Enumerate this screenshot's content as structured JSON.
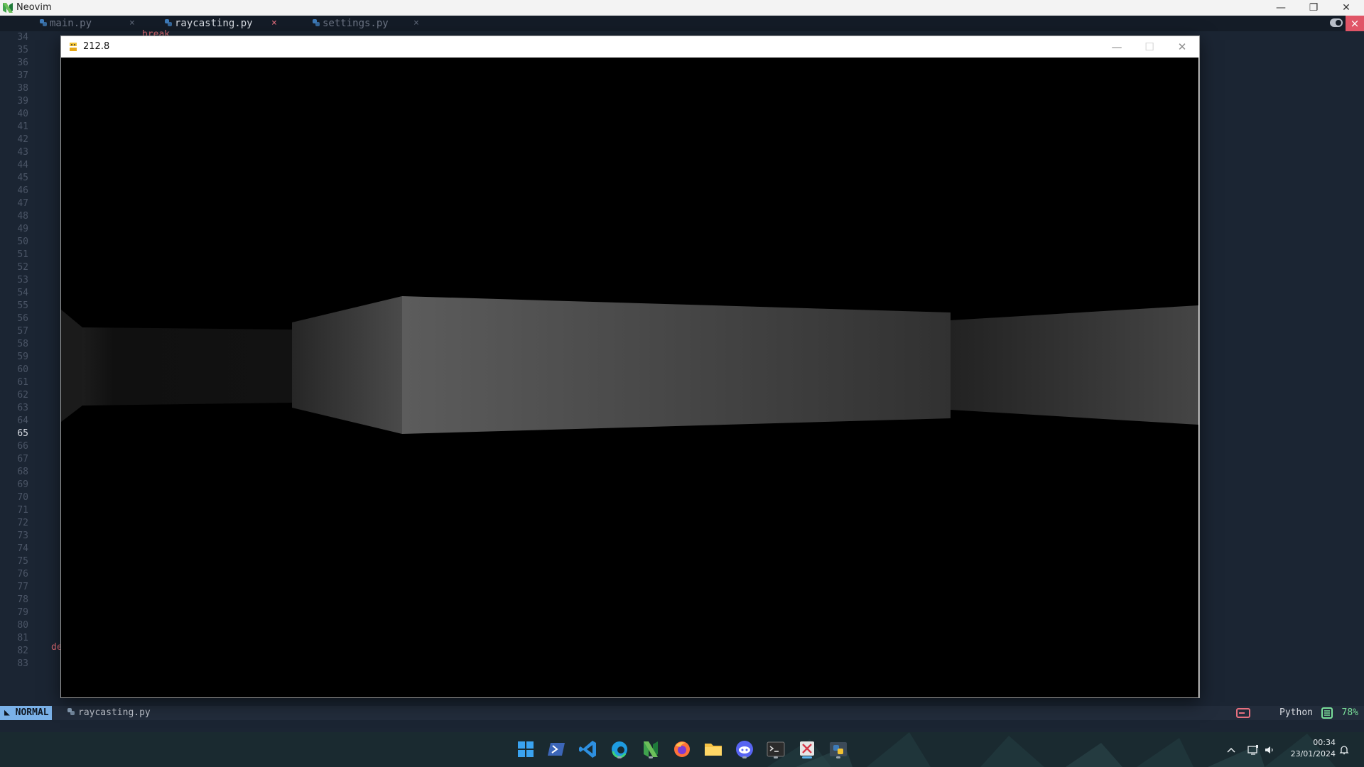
{
  "neovim": {
    "window_title": "Neovim",
    "tabs": [
      {
        "label": "main.py",
        "active": false
      },
      {
        "label": "raycasting.py",
        "active": true
      },
      {
        "label": "settings.py",
        "active": false
      }
    ],
    "close_glyph": "×",
    "line_numbers": [
      "34",
      "35",
      "36",
      "37",
      "38",
      "39",
      "40",
      "41",
      "42",
      "43",
      "44",
      "45",
      "46",
      "47",
      "48",
      "49",
      "50",
      "51",
      "52",
      "53",
      "54",
      "55",
      "56",
      "57",
      "58",
      "59",
      "60",
      "61",
      "62",
      "63",
      "64",
      "65",
      "66",
      "67",
      "68",
      "69",
      "70",
      "71",
      "72",
      "73",
      "74",
      "75",
      "76",
      "77",
      "78",
      "79",
      "80",
      "81",
      "82",
      "83"
    ],
    "current_line": "65",
    "code_fragments": {
      "top": "break",
      "bottom": "de"
    },
    "statusline": {
      "mode": "NORMAL",
      "file": "raycasting.py",
      "language": "Python",
      "percent": "78%"
    }
  },
  "pygame_window": {
    "title": "212.8",
    "controls": {
      "minimize": "—",
      "maximize": "☐",
      "close": "✕"
    }
  },
  "taskbar": {
    "apps": [
      {
        "name": "start",
        "running": false
      },
      {
        "name": "powershell",
        "running": false
      },
      {
        "name": "vscode",
        "running": false
      },
      {
        "name": "edge",
        "running": true
      },
      {
        "name": "neovim",
        "running": true
      },
      {
        "name": "firefox",
        "running": false
      },
      {
        "name": "file-explorer",
        "running": false
      },
      {
        "name": "discord",
        "running": true
      },
      {
        "name": "terminal",
        "running": true
      },
      {
        "name": "snipping-tool",
        "running": true,
        "active": true
      },
      {
        "name": "python",
        "running": true
      }
    ],
    "clock": {
      "time": "00:34",
      "date": "23/01/2024"
    }
  },
  "colors": {
    "editor_bg": "#1b2533",
    "mode_bg": "#7ab1e8",
    "accent_red": "#e05567",
    "percent_green": "#7adf9a"
  }
}
